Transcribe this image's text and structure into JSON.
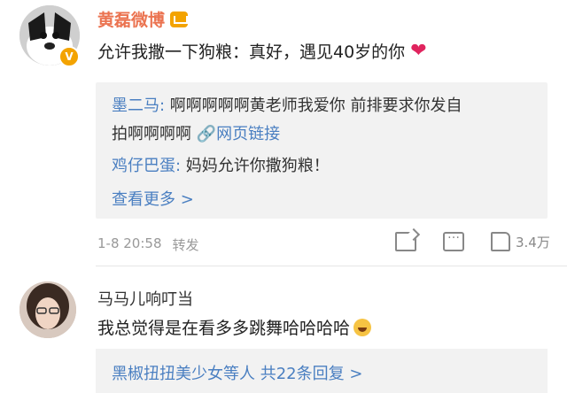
{
  "post": {
    "author": "黄磊微博",
    "verified_badge": "V",
    "text": "允许我撒一下狗粮：真好，遇见40岁的你",
    "heart_icon": "❤"
  },
  "quote": {
    "lines": [
      {
        "user": "墨二马:",
        "text": " 啊啊啊啊啊黄老师我爱你 前排要求你发自"
      },
      {
        "text": "拍啊啊啊啊 ",
        "link": "网页链接"
      },
      {
        "user": "鸡仔巴蛋:",
        "text": " 妈妈允许你撒狗粮！"
      }
    ],
    "more": "查看更多 >"
  },
  "meta": {
    "time": "1-8 20:58",
    "forward": "转发",
    "likes": "3.4万"
  },
  "comment": {
    "user": "马马儿响叮当",
    "text": "我总觉得是在看多多跳舞哈哈哈哈",
    "reply_summary": "黑椒扭扭美少女等人 共22条回复 >"
  }
}
